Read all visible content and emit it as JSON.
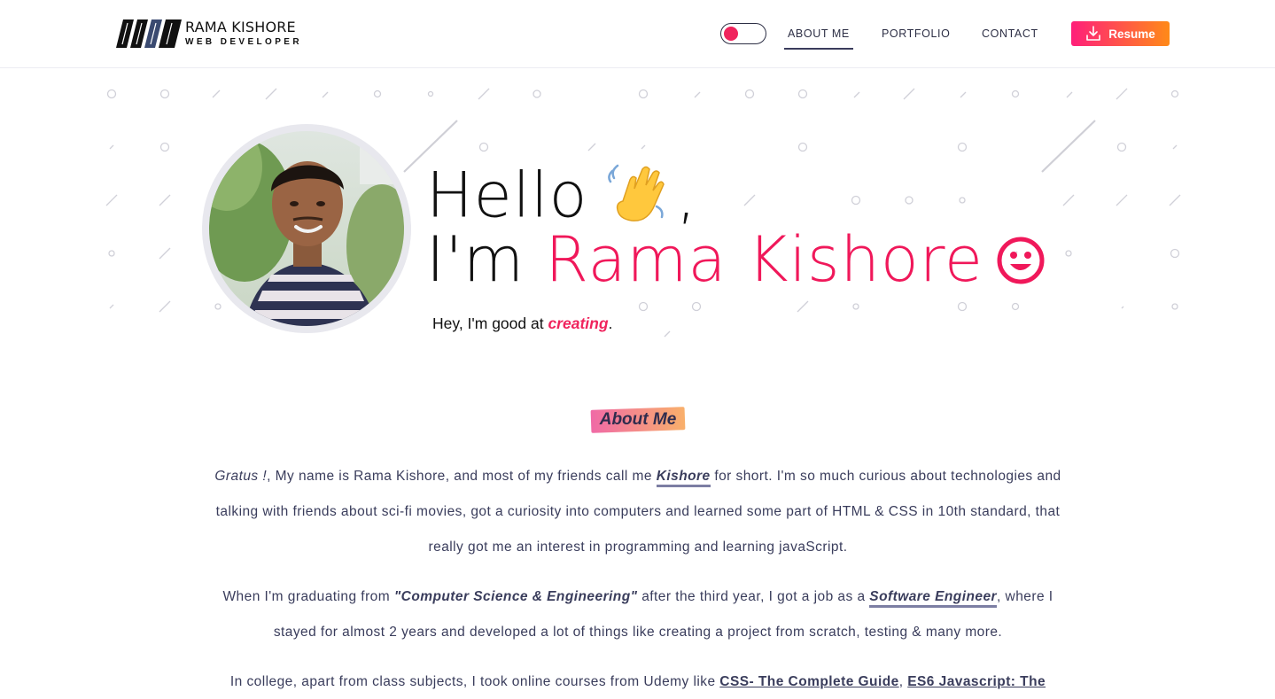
{
  "brand": {
    "name": "RAMA KISHORE",
    "subtitle": "WEB DEVELOPER"
  },
  "nav": {
    "items": [
      {
        "label": "ABOUT ME",
        "active": true
      },
      {
        "label": "PORTFOLIO",
        "active": false
      },
      {
        "label": "CONTACT",
        "active": false
      }
    ],
    "resume_label": "Resume",
    "theme_toggle_on": false
  },
  "hero": {
    "line1": "Hello",
    "comma": ",",
    "line2_prefix": "I'm",
    "name": "Rama Kishore",
    "tagline_prefix": "Hey, I'm good at",
    "tagline_word": "creating",
    "tagline_suffix": "."
  },
  "about": {
    "title": "About Me",
    "p1": {
      "greeting": "Gratus !",
      "t1": ", My name is Rama Kishore, and most of my friends call me ",
      "nickname": "Kishore",
      "t2": " for short. I'm so much curious about technologies and talking with friends about sci-fi movies, got a curiosity into computers and learned some part of HTML & CSS in 10th standard, that really got me an interest in programming and learning javaScript."
    },
    "p2": {
      "t1": "When I'm graduating from ",
      "degree": "\"Computer Science & Engineering\"",
      "t2": " after the third year, I got a job as a ",
      "role": "Software Engineer",
      "t3": ", where I stayed for almost 2 years and developed a lot of things like creating a project from scratch, testing & many more."
    },
    "p3": {
      "t1": "In college, apart from class subjects, I took online courses from Udemy like ",
      "course1": "CSS- The Complete Guide",
      "sep": ", ",
      "course2": "ES6 Javascript: The"
    }
  },
  "colors": {
    "accent": "#f0185a",
    "text": "#3a3d5c",
    "resume_from": "#ff1f7a",
    "resume_to": "#ff8a18"
  },
  "icons": [
    "logo-mark",
    "download-icon",
    "waving-hand-icon",
    "smiley-icon"
  ]
}
